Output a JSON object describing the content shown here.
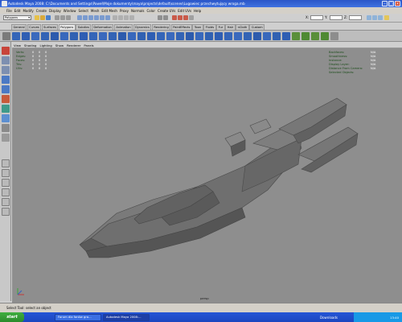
{
  "window": {
    "title": "Autodesk Maya 2008: C:\\Documents and Settings\\Paweł\\Moje dokumenty\\maya\\projects\\default\\scenes\\Lugowiec przechwytujący wroga.mb"
  },
  "menubar": [
    "File",
    "Edit",
    "Modify",
    "Create",
    "Display",
    "Window",
    "Select",
    "Mesh",
    "Edit Mesh",
    "Proxy",
    "Normals",
    "Color",
    "Create UVs",
    "Edit UVs",
    "Help"
  ],
  "statusline": {
    "mode": "Polygons",
    "axes": [
      "X:",
      "Y:",
      "Z:"
    ]
  },
  "shelf_tabs": [
    "General",
    "Curves",
    "Surfaces",
    "Polygons",
    "Subdivs",
    "Deformation",
    "Animation",
    "Dynamics",
    "Rendering",
    "PaintEffects",
    "Toon",
    "Fluids",
    "Fur",
    "Hair",
    "nCloth",
    "Custom"
  ],
  "shelf_active_tab": "Polygons",
  "panel_menu": [
    "View",
    "Shading",
    "Lighting",
    "Show",
    "Renderer",
    "Panels"
  ],
  "hud_left": [
    {
      "label": "Verts:",
      "values": [
        "0",
        "0",
        "0"
      ]
    },
    {
      "label": "Edges:",
      "values": [
        "0",
        "0",
        "0"
      ]
    },
    {
      "label": "Faces:",
      "values": [
        "0",
        "0",
        "0"
      ]
    },
    {
      "label": "Tris:",
      "values": [
        "0",
        "0",
        "0"
      ]
    },
    {
      "label": "UVs:",
      "values": [
        "0",
        "0",
        "0"
      ]
    }
  ],
  "hud_right": [
    {
      "label": "Backfaces:",
      "value": "N/A"
    },
    {
      "label": "Smoothness:",
      "value": "N/A"
    },
    {
      "label": "Instance:",
      "value": "N/A"
    },
    {
      "label": "Display Layer:",
      "value": "N/A"
    },
    {
      "label": "Distance From Camera:",
      "value": "N/A"
    },
    {
      "label": "Selected Objects:",
      "value": ""
    }
  ],
  "camera_label": "persp",
  "help_line": "Select Tool: select an object",
  "taskbar": {
    "start_label": "start",
    "items": [
      {
        "label": "Forum dla fanów gra...",
        "active": false
      },
      {
        "label": "Autodesk Maya 2008:...",
        "active": true
      }
    ],
    "downloads_label": "Downloads",
    "clock": "13:40"
  },
  "colors": {
    "viewport_bg": "#8e8e8e",
    "model_face": "#6f6f6f",
    "model_dark": "#515151",
    "title_bar": "#2b56c8",
    "taskbar": "#2455d6",
    "hud_label": "#1c4d1a"
  }
}
